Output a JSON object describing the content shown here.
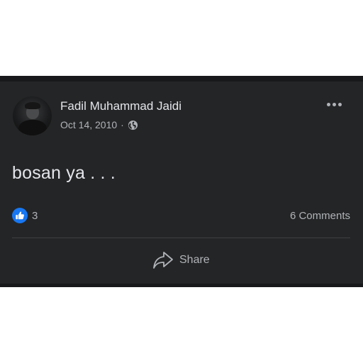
{
  "post": {
    "author": "Fadil Muhammad Jaidi",
    "date": "Oct 14, 2010",
    "separator": "·",
    "message": "bosan ya . . .",
    "reactions": {
      "count": "3",
      "icon": "like-icon",
      "color": "#1877f2"
    },
    "comments_label": "6 Comments",
    "share_label": "Share"
  },
  "colors": {
    "background": "#242526",
    "text": "#e4e6eb",
    "muted": "#b0b3b8",
    "divider": "#3e4042"
  }
}
